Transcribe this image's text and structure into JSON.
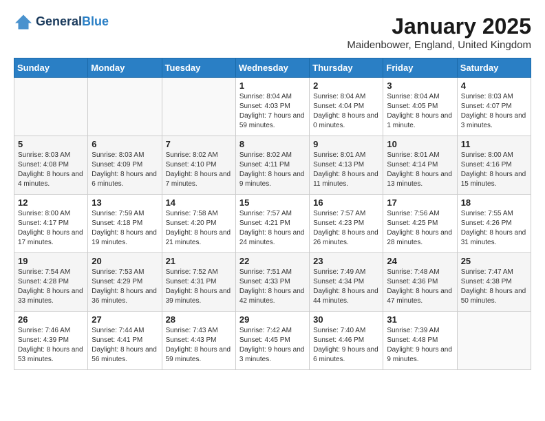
{
  "logo": {
    "line1": "General",
    "line2": "Blue"
  },
  "title": "January 2025",
  "subtitle": "Maidenbower, England, United Kingdom",
  "days_header": [
    "Sunday",
    "Monday",
    "Tuesday",
    "Wednesday",
    "Thursday",
    "Friday",
    "Saturday"
  ],
  "weeks": [
    [
      {
        "day": "",
        "text": ""
      },
      {
        "day": "",
        "text": ""
      },
      {
        "day": "",
        "text": ""
      },
      {
        "day": "1",
        "text": "Sunrise: 8:04 AM\nSunset: 4:03 PM\nDaylight: 7 hours and 59 minutes."
      },
      {
        "day": "2",
        "text": "Sunrise: 8:04 AM\nSunset: 4:04 PM\nDaylight: 8 hours and 0 minutes."
      },
      {
        "day": "3",
        "text": "Sunrise: 8:04 AM\nSunset: 4:05 PM\nDaylight: 8 hours and 1 minute."
      },
      {
        "day": "4",
        "text": "Sunrise: 8:03 AM\nSunset: 4:07 PM\nDaylight: 8 hours and 3 minutes."
      }
    ],
    [
      {
        "day": "5",
        "text": "Sunrise: 8:03 AM\nSunset: 4:08 PM\nDaylight: 8 hours and 4 minutes."
      },
      {
        "day": "6",
        "text": "Sunrise: 8:03 AM\nSunset: 4:09 PM\nDaylight: 8 hours and 6 minutes."
      },
      {
        "day": "7",
        "text": "Sunrise: 8:02 AM\nSunset: 4:10 PM\nDaylight: 8 hours and 7 minutes."
      },
      {
        "day": "8",
        "text": "Sunrise: 8:02 AM\nSunset: 4:11 PM\nDaylight: 8 hours and 9 minutes."
      },
      {
        "day": "9",
        "text": "Sunrise: 8:01 AM\nSunset: 4:13 PM\nDaylight: 8 hours and 11 minutes."
      },
      {
        "day": "10",
        "text": "Sunrise: 8:01 AM\nSunset: 4:14 PM\nDaylight: 8 hours and 13 minutes."
      },
      {
        "day": "11",
        "text": "Sunrise: 8:00 AM\nSunset: 4:16 PM\nDaylight: 8 hours and 15 minutes."
      }
    ],
    [
      {
        "day": "12",
        "text": "Sunrise: 8:00 AM\nSunset: 4:17 PM\nDaylight: 8 hours and 17 minutes."
      },
      {
        "day": "13",
        "text": "Sunrise: 7:59 AM\nSunset: 4:18 PM\nDaylight: 8 hours and 19 minutes."
      },
      {
        "day": "14",
        "text": "Sunrise: 7:58 AM\nSunset: 4:20 PM\nDaylight: 8 hours and 21 minutes."
      },
      {
        "day": "15",
        "text": "Sunrise: 7:57 AM\nSunset: 4:21 PM\nDaylight: 8 hours and 24 minutes."
      },
      {
        "day": "16",
        "text": "Sunrise: 7:57 AM\nSunset: 4:23 PM\nDaylight: 8 hours and 26 minutes."
      },
      {
        "day": "17",
        "text": "Sunrise: 7:56 AM\nSunset: 4:25 PM\nDaylight: 8 hours and 28 minutes."
      },
      {
        "day": "18",
        "text": "Sunrise: 7:55 AM\nSunset: 4:26 PM\nDaylight: 8 hours and 31 minutes."
      }
    ],
    [
      {
        "day": "19",
        "text": "Sunrise: 7:54 AM\nSunset: 4:28 PM\nDaylight: 8 hours and 33 minutes."
      },
      {
        "day": "20",
        "text": "Sunrise: 7:53 AM\nSunset: 4:29 PM\nDaylight: 8 hours and 36 minutes."
      },
      {
        "day": "21",
        "text": "Sunrise: 7:52 AM\nSunset: 4:31 PM\nDaylight: 8 hours and 39 minutes."
      },
      {
        "day": "22",
        "text": "Sunrise: 7:51 AM\nSunset: 4:33 PM\nDaylight: 8 hours and 42 minutes."
      },
      {
        "day": "23",
        "text": "Sunrise: 7:49 AM\nSunset: 4:34 PM\nDaylight: 8 hours and 44 minutes."
      },
      {
        "day": "24",
        "text": "Sunrise: 7:48 AM\nSunset: 4:36 PM\nDaylight: 8 hours and 47 minutes."
      },
      {
        "day": "25",
        "text": "Sunrise: 7:47 AM\nSunset: 4:38 PM\nDaylight: 8 hours and 50 minutes."
      }
    ],
    [
      {
        "day": "26",
        "text": "Sunrise: 7:46 AM\nSunset: 4:39 PM\nDaylight: 8 hours and 53 minutes."
      },
      {
        "day": "27",
        "text": "Sunrise: 7:44 AM\nSunset: 4:41 PM\nDaylight: 8 hours and 56 minutes."
      },
      {
        "day": "28",
        "text": "Sunrise: 7:43 AM\nSunset: 4:43 PM\nDaylight: 8 hours and 59 minutes."
      },
      {
        "day": "29",
        "text": "Sunrise: 7:42 AM\nSunset: 4:45 PM\nDaylight: 9 hours and 3 minutes."
      },
      {
        "day": "30",
        "text": "Sunrise: 7:40 AM\nSunset: 4:46 PM\nDaylight: 9 hours and 6 minutes."
      },
      {
        "day": "31",
        "text": "Sunrise: 7:39 AM\nSunset: 4:48 PM\nDaylight: 9 hours and 9 minutes."
      },
      {
        "day": "",
        "text": ""
      }
    ]
  ]
}
